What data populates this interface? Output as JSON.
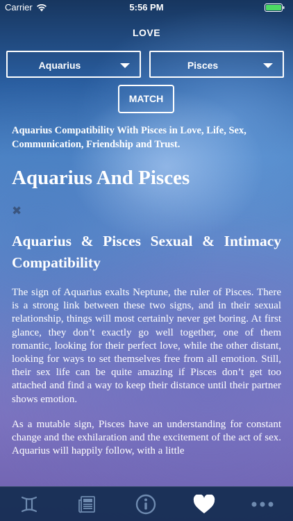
{
  "status_bar": {
    "carrier": "Carrier",
    "time": "5:56 PM"
  },
  "nav": {
    "title": "LOVE"
  },
  "selectors": {
    "first": "Aquarius",
    "second": "Pisces"
  },
  "match_label": "MATCH",
  "article": {
    "intro": "Aquarius Compatibility With Pisces in Love, Life, Sex, Communication, Friendship and Trust.",
    "title": "Aquarius And Pisces",
    "section_heading": "Aquarius & Pisces Sexual & Intimacy Compatibility",
    "paragraphs": [
      "The sign of Aquarius exalts Neptune, the ruler of Pisces. There is a strong link between these two signs, and in their sexual relationship, things will most certainly never get boring. At first glance, they don’t exactly go well together, one of them romantic, looking for their perfect love, while the other distant, looking for ways to set themselves free from all emotion. Still, their sex life can be quite amazing if Pisces don’t get too attached and find a way to keep their distance until their partner shows emotion.",
      "As a mutable sign, Pisces have an understanding for constant change and the exhilaration and the excitement of the act of sex. Aquarius will happily follow, with a little"
    ]
  },
  "tabs": [
    {
      "icon": "gemini-icon",
      "active": false
    },
    {
      "icon": "newspaper-icon",
      "active": false
    },
    {
      "icon": "info-icon",
      "active": false
    },
    {
      "icon": "heart-icon",
      "active": true
    },
    {
      "icon": "more-icon",
      "active": false
    }
  ],
  "colors": {
    "active_tab": "#ffffff",
    "inactive_tab": "#6f8bb0"
  }
}
